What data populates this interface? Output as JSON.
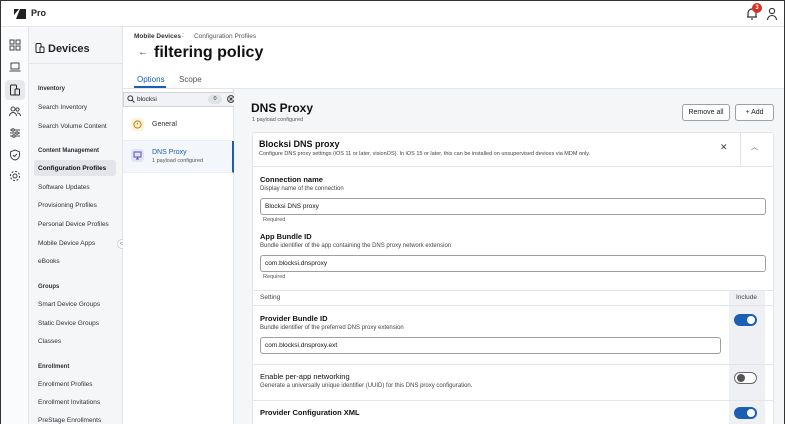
{
  "app": {
    "name": "Pro",
    "notification_count": "3"
  },
  "sidebar": {
    "title": "Devices",
    "sections": [
      {
        "heading": "Inventory",
        "items": [
          "Search Inventory",
          "Search Volume Content"
        ]
      },
      {
        "heading": "Content Management",
        "items": [
          "Configuration Profiles",
          "Software Updates",
          "Provisioning Profiles",
          "Personal Device Profiles",
          "Mobile Device Apps",
          "eBooks"
        ]
      },
      {
        "heading": "Groups",
        "items": [
          "Smart Device Groups",
          "Static Device Groups",
          "Classes"
        ]
      },
      {
        "heading": "Enrollment",
        "items": [
          "Enrollment Profiles",
          "Enrollment Invitations",
          "PreStage Enrollments"
        ]
      }
    ],
    "active_item": "Configuration Profiles"
  },
  "header": {
    "breadcrumb": [
      "Mobile Devices",
      "Configuration Profiles"
    ],
    "breadcrumb_sep": ":",
    "title": "filtering policy",
    "tabs": [
      "Options",
      "Scope"
    ],
    "active_tab": "Options"
  },
  "payloads": {
    "search_value": "blocksi",
    "count": "0",
    "items": [
      {
        "label": "General",
        "sub": ""
      },
      {
        "label": "DNS Proxy",
        "sub": "1 payload configured"
      }
    ]
  },
  "detail": {
    "title": "DNS Proxy",
    "subtitle": "1 payload configured",
    "remove_all_label": "Remove all",
    "add_label": "+ Add",
    "card": {
      "title": "Blocksi DNS proxy",
      "description": "Configure DNS proxy settings (iOS 11 or later, visionOS). In iOS 15 or later, this can be installed on unsupervised devices via MDM only.",
      "fields": {
        "connection_name": {
          "label": "Connection name",
          "help": "Display name of the connection",
          "value": "Blocksi DNS proxy",
          "required": "Required"
        },
        "app_bundle_id": {
          "label": "App Bundle ID",
          "help": "Bundle identifier of the app containing the DNS proxy network extension",
          "value": "com.blocksi.dnsproxy",
          "required": "Required"
        }
      },
      "setting_label": "Setting",
      "include_label": "Include",
      "settings": [
        {
          "label": "Provider Bundle ID",
          "help": "Bundle identifier of the preferred DNS proxy extension",
          "value": "com.blocksi.dnsproxy.ext",
          "enabled": true
        },
        {
          "label": "Enable per-app networking",
          "help": "Generate a universally unique identifier (UUID) for this DNS proxy configuration.",
          "enabled": false
        },
        {
          "label": "Provider Configuration XML",
          "help": "",
          "enabled": true
        }
      ]
    }
  },
  "colors": {
    "accent": "#1a5fb4",
    "badge": "#d93025"
  }
}
